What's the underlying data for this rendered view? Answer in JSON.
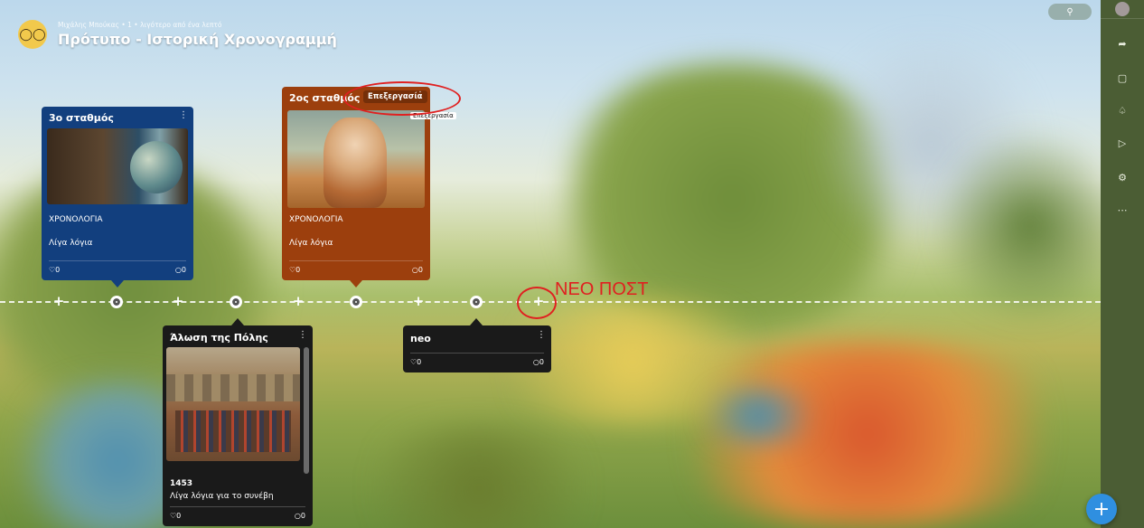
{
  "header": {
    "meta": "Μιχάλης Μπούκας • 1 • λιγότερο από ένα λεπτό",
    "title": "Πρότυπο - Ιστορική Χρονογραμμή",
    "logo_icon": "nerd-face-icon",
    "search_icon": "search-icon"
  },
  "rail": {
    "icons": [
      "share-icon",
      "screen-icon",
      "bell-icon",
      "play-icon",
      "gear-icon",
      "more-icon"
    ]
  },
  "posts": [
    {
      "title": "3ο σταθμός",
      "subtitle": "ΧΡΟΝΟΛΟΓΙΑ",
      "body": "Λίγα λόγια",
      "likes": "0",
      "comments": "0",
      "color": "#123f7e"
    },
    {
      "title": "2ος σταθμός",
      "subtitle": "ΧΡΟΝΟΛΟΓΙΑ",
      "body": "Λίγα λόγια",
      "likes": "0",
      "comments": "0",
      "color": "#9c3f0d",
      "edit_label": "Επεξεργασία",
      "tooltip": "Επεξεργασία"
    },
    {
      "title": "Άλωση της Πόλης",
      "subtitle": "1453",
      "body": "Λίγα λόγια για το συνέβη",
      "likes": "0",
      "comments": "0",
      "color": "#1a1a1a"
    },
    {
      "title": "neo",
      "likes": "0",
      "comments": "0",
      "color": "#1a1a1a"
    }
  ],
  "annotation": {
    "label": "ΝΕΟ ΠΟΣΤ",
    "color": "#e02020"
  },
  "fab": {
    "icon": "plus-icon",
    "color": "#2f8fe0"
  }
}
